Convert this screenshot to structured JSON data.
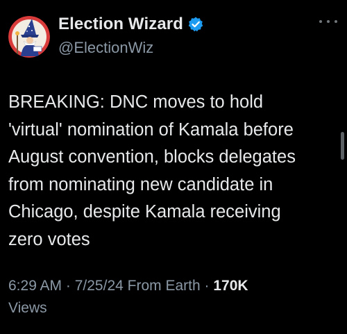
{
  "author": {
    "display_name": "Election Wizard",
    "handle": "@ElectionWiz",
    "verified_icon": "verified-badge-icon",
    "avatar_icon": "wizard-avatar-icon"
  },
  "menu": {
    "more_icon": "more-options-icon"
  },
  "tweet": {
    "lines": [
      "BREAKING: DNC moves to hold",
      "'virtual' nomination of Kamala before",
      "August convention, blocks delegates",
      "from nominating new candidate in",
      "Chicago, despite Kamala receiving",
      "zero votes"
    ]
  },
  "meta": {
    "time": "6:29 AM",
    "sep1": " · ",
    "date": "7/25/24",
    "source": " From Earth",
    "sep2": " · ",
    "views_count": "170K",
    "views_label": "Views"
  },
  "colors": {
    "background": "#000000",
    "text_primary": "#e7e9ea",
    "text_secondary": "#8b98a5",
    "verified_blue": "#1d9bf0",
    "avatar_red": "#d93a3a"
  }
}
